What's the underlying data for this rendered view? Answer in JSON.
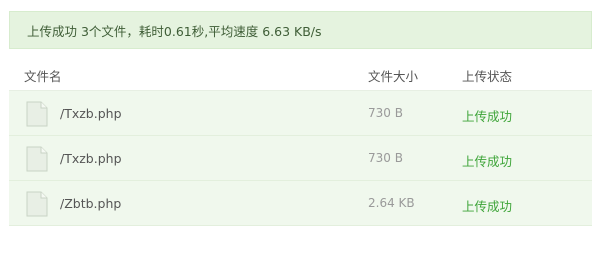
{
  "summary": {
    "text": "上传成功 3个文件，耗时0.61秒,平均速度 6.63 KB/s"
  },
  "table": {
    "headers": {
      "name": "文件名",
      "size": "文件大小",
      "status": "上传状态"
    },
    "rows": [
      {
        "name": "/Txzb.php",
        "size": "730 B",
        "status": "上传成功",
        "icon": "file-icon"
      },
      {
        "name": "/Txzb.php",
        "size": "730 B",
        "status": "上传成功",
        "icon": "file-icon"
      },
      {
        "name": "/Zbtb.php",
        "size": "2.64 KB",
        "status": "上传成功",
        "icon": "file-icon"
      }
    ]
  },
  "colors": {
    "banner_bg": "#e5f3df",
    "row_bg": "#f0f8ed",
    "success": "#3fa53a"
  }
}
